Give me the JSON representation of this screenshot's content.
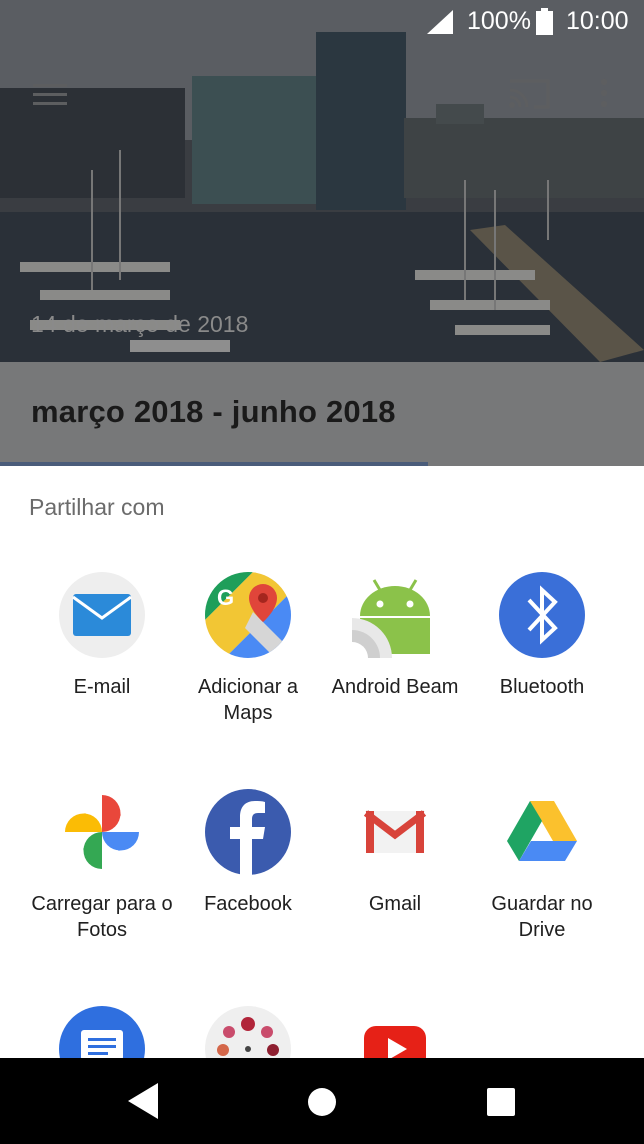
{
  "status_bar": {
    "battery": "100%",
    "time": "10:00"
  },
  "background": {
    "date": "14 de março de 2018",
    "title": "março 2018 - junho 2018"
  },
  "share_sheet": {
    "title": "Partilhar com",
    "targets": [
      {
        "label": "E-mail",
        "icon": "email-icon"
      },
      {
        "label": "Adicionar a\nMaps",
        "icon": "google-maps-icon"
      },
      {
        "label": "Android Beam",
        "icon": "android-beam-icon"
      },
      {
        "label": "Bluetooth",
        "icon": "bluetooth-icon"
      },
      {
        "label": "Carregar para o\nFotos",
        "icon": "google-photos-icon"
      },
      {
        "label": "Facebook",
        "icon": "facebook-icon"
      },
      {
        "label": "Gmail",
        "icon": "gmail-icon"
      },
      {
        "label": "Guardar no\nDrive",
        "icon": "google-drive-icon"
      },
      {
        "label": "",
        "icon": "messages-icon"
      },
      {
        "label": "",
        "icon": "flower-app-icon"
      },
      {
        "label": "",
        "icon": "youtube-icon"
      }
    ]
  },
  "navigation": {
    "back": "back-icon",
    "home": "home-icon",
    "recents": "recents-icon"
  },
  "colors": {
    "sheet_background": "#ffffff",
    "nav_bar": "#000000",
    "bluetooth_blue": "#3a6fd8",
    "facebook_blue": "#3b5bae"
  }
}
